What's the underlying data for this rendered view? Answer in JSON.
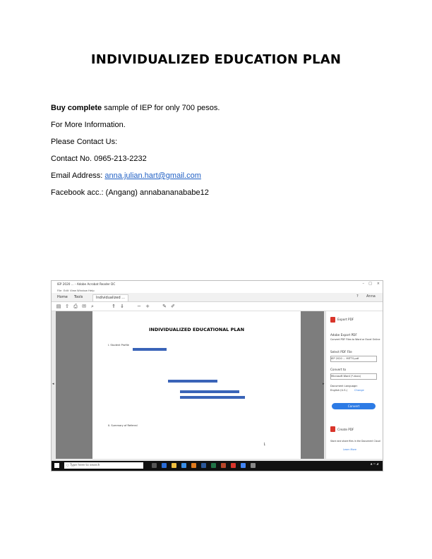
{
  "document": {
    "title": "INDIVIDUALIZED EDUCATION PLAN",
    "line1_bold": "Buy complete",
    "line1_rest": " sample of IEP for only 700 pesos.",
    "line2": "For More Information.",
    "line3": "Please Contact Us:",
    "line4": "Contact No. 0965-213-2232",
    "email_label": "Email Address: ",
    "email": "anna.julian.hart@gmail.com",
    "facebook": "Facebook acc.: (Angang) annabananababe12"
  },
  "screenshot": {
    "window_title": "IEP 2020 ... - Adobe Acrobat Reader DC",
    "menu_items": [
      "File",
      "Edit",
      "View",
      "Window",
      "Help"
    ],
    "tabs": [
      "Home",
      "Tools",
      "Individualized ..."
    ],
    "account": "Anna",
    "page_title": "INDIVIDUALIZED EDUCATIONAL PLAN",
    "section1": "I. Student Profile",
    "section2": "II. Summary of Referral",
    "page_number": "1",
    "panel": {
      "export_title": "Export PDF",
      "product": "Adobe Export PDF",
      "description": "Convert PDF Files to Word or Excel Online",
      "select_label": "Select PDF File",
      "file_value": "IEP 2020 ... MITTS.pdf",
      "convert_to_label": "Convert to",
      "format_value": "Microsoft Word (*.docx)",
      "language_label": "Document Language:",
      "language_value": "English (U.S.)",
      "change_link": "Change",
      "convert_button": "Convert",
      "create_pdf": "Create PDF",
      "footer_text": "Store and share files in the Document Cloud",
      "learn_more": "Learn More"
    },
    "taskbar": {
      "search_placeholder": "Type here to search"
    }
  },
  "colors": {
    "link": "#1f5fc4",
    "highlight_blue": "#3a64b8",
    "convert_button": "#2d7be5",
    "pdf_red": "#d9352b"
  }
}
